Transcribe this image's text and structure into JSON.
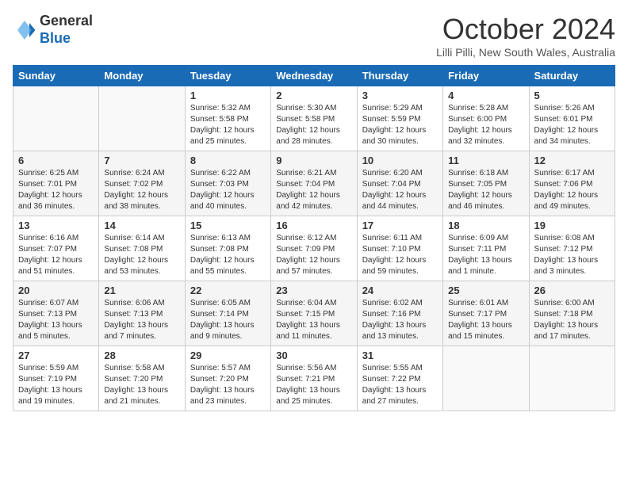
{
  "logo": {
    "general": "General",
    "blue": "Blue"
  },
  "title": "October 2024",
  "location": "Lilli Pilli, New South Wales, Australia",
  "days_header": [
    "Sunday",
    "Monday",
    "Tuesday",
    "Wednesday",
    "Thursday",
    "Friday",
    "Saturday"
  ],
  "weeks": [
    [
      {
        "num": "",
        "info": ""
      },
      {
        "num": "",
        "info": ""
      },
      {
        "num": "1",
        "info": "Sunrise: 5:32 AM\nSunset: 5:58 PM\nDaylight: 12 hours\nand 25 minutes."
      },
      {
        "num": "2",
        "info": "Sunrise: 5:30 AM\nSunset: 5:58 PM\nDaylight: 12 hours\nand 28 minutes."
      },
      {
        "num": "3",
        "info": "Sunrise: 5:29 AM\nSunset: 5:59 PM\nDaylight: 12 hours\nand 30 minutes."
      },
      {
        "num": "4",
        "info": "Sunrise: 5:28 AM\nSunset: 6:00 PM\nDaylight: 12 hours\nand 32 minutes."
      },
      {
        "num": "5",
        "info": "Sunrise: 5:26 AM\nSunset: 6:01 PM\nDaylight: 12 hours\nand 34 minutes."
      }
    ],
    [
      {
        "num": "6",
        "info": "Sunrise: 6:25 AM\nSunset: 7:01 PM\nDaylight: 12 hours\nand 36 minutes."
      },
      {
        "num": "7",
        "info": "Sunrise: 6:24 AM\nSunset: 7:02 PM\nDaylight: 12 hours\nand 38 minutes."
      },
      {
        "num": "8",
        "info": "Sunrise: 6:22 AM\nSunset: 7:03 PM\nDaylight: 12 hours\nand 40 minutes."
      },
      {
        "num": "9",
        "info": "Sunrise: 6:21 AM\nSunset: 7:04 PM\nDaylight: 12 hours\nand 42 minutes."
      },
      {
        "num": "10",
        "info": "Sunrise: 6:20 AM\nSunset: 7:04 PM\nDaylight: 12 hours\nand 44 minutes."
      },
      {
        "num": "11",
        "info": "Sunrise: 6:18 AM\nSunset: 7:05 PM\nDaylight: 12 hours\nand 46 minutes."
      },
      {
        "num": "12",
        "info": "Sunrise: 6:17 AM\nSunset: 7:06 PM\nDaylight: 12 hours\nand 49 minutes."
      }
    ],
    [
      {
        "num": "13",
        "info": "Sunrise: 6:16 AM\nSunset: 7:07 PM\nDaylight: 12 hours\nand 51 minutes."
      },
      {
        "num": "14",
        "info": "Sunrise: 6:14 AM\nSunset: 7:08 PM\nDaylight: 12 hours\nand 53 minutes."
      },
      {
        "num": "15",
        "info": "Sunrise: 6:13 AM\nSunset: 7:08 PM\nDaylight: 12 hours\nand 55 minutes."
      },
      {
        "num": "16",
        "info": "Sunrise: 6:12 AM\nSunset: 7:09 PM\nDaylight: 12 hours\nand 57 minutes."
      },
      {
        "num": "17",
        "info": "Sunrise: 6:11 AM\nSunset: 7:10 PM\nDaylight: 12 hours\nand 59 minutes."
      },
      {
        "num": "18",
        "info": "Sunrise: 6:09 AM\nSunset: 7:11 PM\nDaylight: 13 hours\nand 1 minute."
      },
      {
        "num": "19",
        "info": "Sunrise: 6:08 AM\nSunset: 7:12 PM\nDaylight: 13 hours\nand 3 minutes."
      }
    ],
    [
      {
        "num": "20",
        "info": "Sunrise: 6:07 AM\nSunset: 7:13 PM\nDaylight: 13 hours\nand 5 minutes."
      },
      {
        "num": "21",
        "info": "Sunrise: 6:06 AM\nSunset: 7:13 PM\nDaylight: 13 hours\nand 7 minutes."
      },
      {
        "num": "22",
        "info": "Sunrise: 6:05 AM\nSunset: 7:14 PM\nDaylight: 13 hours\nand 9 minutes."
      },
      {
        "num": "23",
        "info": "Sunrise: 6:04 AM\nSunset: 7:15 PM\nDaylight: 13 hours\nand 11 minutes."
      },
      {
        "num": "24",
        "info": "Sunrise: 6:02 AM\nSunset: 7:16 PM\nDaylight: 13 hours\nand 13 minutes."
      },
      {
        "num": "25",
        "info": "Sunrise: 6:01 AM\nSunset: 7:17 PM\nDaylight: 13 hours\nand 15 minutes."
      },
      {
        "num": "26",
        "info": "Sunrise: 6:00 AM\nSunset: 7:18 PM\nDaylight: 13 hours\nand 17 minutes."
      }
    ],
    [
      {
        "num": "27",
        "info": "Sunrise: 5:59 AM\nSunset: 7:19 PM\nDaylight: 13 hours\nand 19 minutes."
      },
      {
        "num": "28",
        "info": "Sunrise: 5:58 AM\nSunset: 7:20 PM\nDaylight: 13 hours\nand 21 minutes."
      },
      {
        "num": "29",
        "info": "Sunrise: 5:57 AM\nSunset: 7:20 PM\nDaylight: 13 hours\nand 23 minutes."
      },
      {
        "num": "30",
        "info": "Sunrise: 5:56 AM\nSunset: 7:21 PM\nDaylight: 13 hours\nand 25 minutes."
      },
      {
        "num": "31",
        "info": "Sunrise: 5:55 AM\nSunset: 7:22 PM\nDaylight: 13 hours\nand 27 minutes."
      },
      {
        "num": "",
        "info": ""
      },
      {
        "num": "",
        "info": ""
      }
    ]
  ]
}
